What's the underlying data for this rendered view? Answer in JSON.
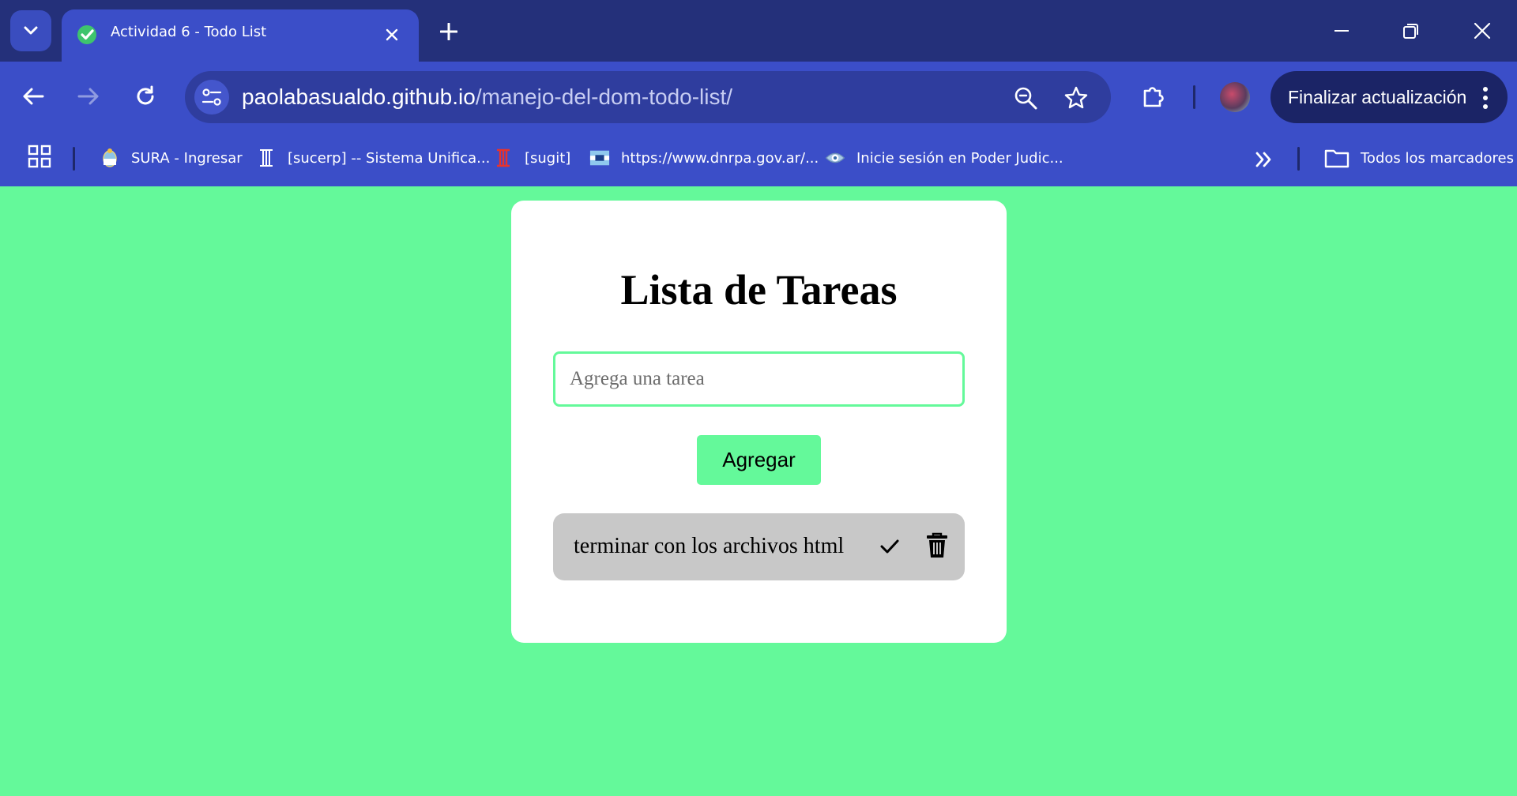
{
  "browser": {
    "tab": {
      "title": "Actividad 6 - Todo List"
    },
    "address": {
      "host": "paolabasualdo.github.io",
      "path": "/manejo-del-dom-todo-list/"
    },
    "update_button": "Finalizar actualización",
    "bookmarks": [
      {
        "label": "SURA - Ingresar",
        "icon": "coat-of-arms-icon"
      },
      {
        "label": "[sucerp] -- Sistema Unifica...",
        "icon": "column-icon"
      },
      {
        "label": "[sugit]",
        "icon": "red-column-icon"
      },
      {
        "label": "https://www.dnrpa.gov.ar/...",
        "icon": "dnrpa-flag-icon"
      },
      {
        "label": "Inicie sesión en Poder Judic...",
        "icon": "eye-logo-icon"
      }
    ],
    "all_bookmarks": "Todos los marcadores"
  },
  "page": {
    "title": "Lista de Tareas",
    "input": {
      "placeholder": "Agrega una tarea",
      "value": ""
    },
    "add_button": "Agregar",
    "tasks": [
      {
        "text": "terminar con los archivos html",
        "done": false
      }
    ]
  },
  "colors": {
    "page_background": "#64f99a",
    "accent": "#64f99a",
    "task_background": "#c8c8c8",
    "chrome_frame": "#24307a",
    "chrome_toolbar": "#3b4ec8"
  }
}
